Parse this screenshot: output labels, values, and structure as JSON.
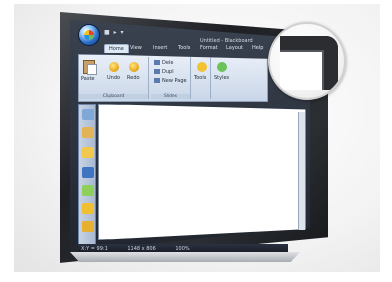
{
  "window": {
    "title": "Untitled - Blackboard",
    "quick_access": "■ ▸ ▾"
  },
  "ribbon": {
    "tabs": [
      "Home",
      "View",
      "Insert",
      "Tools",
      "Format",
      "Layout",
      "Help"
    ],
    "active_tab": "Home",
    "groups": {
      "clipboard": {
        "label": "Clipboard",
        "paste": "Paste",
        "undo": "Undo",
        "redo": "Redo"
      },
      "slides": {
        "label": "Slides",
        "items": [
          "Dele",
          "Dupl",
          "New Page"
        ]
      },
      "tools": {
        "label": "Tools"
      },
      "styles": {
        "label": "Styles"
      }
    }
  },
  "sidebar": {
    "icons": [
      "pages-icon",
      "folder-icon",
      "open-icon",
      "board-icon",
      "arrow-left-icon",
      "arrow-right-icon",
      "up-down-icon"
    ]
  },
  "status_bar": {
    "position": "X:Y = 99:1",
    "size": "1148 x 806",
    "zoom": "100%"
  },
  "colors": {
    "frame": "#1e2024",
    "ribbon": "#dfe8f5",
    "canvas": "#ffffff",
    "accent": "#2c70c9"
  }
}
